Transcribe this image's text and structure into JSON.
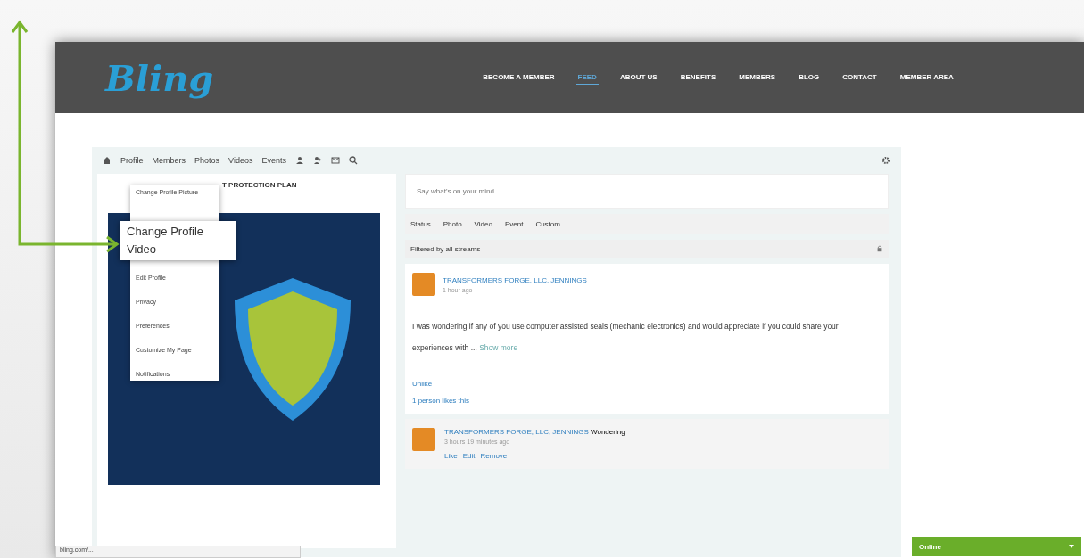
{
  "header": {
    "logo": "Bling",
    "nav": [
      {
        "label": "BECOME A MEMBER",
        "selected": false
      },
      {
        "label": "FEED",
        "selected": true
      },
      {
        "label": "ABOUT US",
        "selected": false
      },
      {
        "label": "BENEFITS",
        "selected": false
      },
      {
        "label": "MEMBERS",
        "selected": false
      },
      {
        "label": "BLOG",
        "selected": false
      },
      {
        "label": "CONTACT",
        "selected": false
      },
      {
        "label": "MEMBER AREA",
        "selected": false
      }
    ]
  },
  "toolbar": {
    "items": [
      "Profile",
      "Members",
      "Photos",
      "Videos",
      "Events"
    ]
  },
  "profile_menu": {
    "items": [
      "Change Profile Picture",
      "Edit Profile",
      "Privacy",
      "Preferences",
      "Customize My Page",
      "Notifications"
    ]
  },
  "callout": {
    "lines": [
      "Change Profile",
      "Video"
    ]
  },
  "card": {
    "title": "T PROTECTION PLAN"
  },
  "composer": {
    "placeholder": "Say what's on your mind...",
    "post_types": [
      "Status",
      "Photo",
      "Video",
      "Event",
      "Custom"
    ]
  },
  "filter": {
    "label": "Filtered by all streams"
  },
  "post": {
    "author": "TRANSFORMERS FORGE, LLC, JENNINGS",
    "time": "1 hour ago",
    "text": "I was wondering if any of you use computer assisted seals (mechanic electronics) and would appreciate if you could share your experiences with ...",
    "show_more": "Show more",
    "like": "Unlike",
    "likes": "1 person likes this"
  },
  "comment": {
    "author": "TRANSFORMERS FORGE, LLC, JENNINGS",
    "text": "Wondering",
    "time": "3 hours 19 minutes ago",
    "actions": [
      "Like",
      "Edit",
      "Remove"
    ]
  },
  "status_url": "bling.com/...",
  "chat": {
    "label": "Online"
  }
}
